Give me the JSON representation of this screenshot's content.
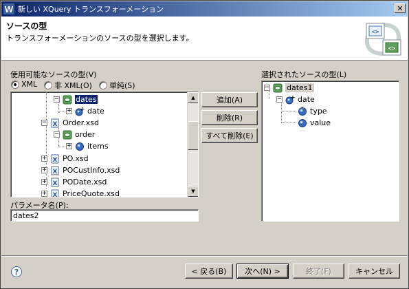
{
  "window": {
    "title": "新しい XQuery トランスフォーメーション"
  },
  "header": {
    "title": "ソースの型",
    "description": "トランスフォーメーションのソースの型を選択します。"
  },
  "left": {
    "label": "使用可能なソースの型(V)",
    "radios": [
      {
        "label": "XML",
        "selected": true
      },
      {
        "label": "非 XML(O)",
        "selected": false
      },
      {
        "label": "単純(S)",
        "selected": false
      }
    ],
    "tree": [
      {
        "label": "dates",
        "icon": "element-group-icon",
        "expander": "-",
        "selected": true
      },
      {
        "label": "date",
        "icon": "element-plus-icon",
        "expander": "+"
      },
      {
        "label": "Order.xsd",
        "icon": "xsd-file-icon",
        "expander": "-"
      },
      {
        "label": "order",
        "icon": "element-group-icon",
        "expander": "-"
      },
      {
        "label": "items",
        "icon": "element-icon",
        "expander": "+"
      },
      {
        "label": "PO.xsd",
        "icon": "xsd-file-icon",
        "expander": "+"
      },
      {
        "label": "POCustInfo.xsd",
        "icon": "xsd-file-icon",
        "expander": "+"
      },
      {
        "label": "PODate.xsd",
        "icon": "xsd-file-icon",
        "expander": "+"
      },
      {
        "label": "PriceQuote.xsd",
        "icon": "xsd-file-icon",
        "expander": "+"
      }
    ],
    "param_label": "パラメータ名(P):",
    "param_value": "dates2"
  },
  "middle": {
    "add": "追加(A)",
    "remove": "削除(R)",
    "remove_all": "すべて削除(E)"
  },
  "right": {
    "label": "選択されたソースの型(L)",
    "tree": [
      {
        "label": "dates1",
        "icon": "element-group-icon",
        "expander": "-"
      },
      {
        "label": "date",
        "icon": "element-plus-icon",
        "expander": "-"
      },
      {
        "label": "type",
        "icon": "element-icon"
      },
      {
        "label": "value",
        "icon": "element-icon"
      }
    ]
  },
  "footer": {
    "back": "< 戻る(B)",
    "next": "次へ(N) >",
    "finish": "終了(F)",
    "cancel": "キャンセル"
  }
}
